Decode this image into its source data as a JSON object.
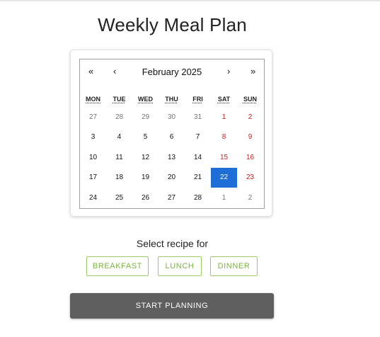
{
  "page": {
    "title": "Weekly Meal Plan"
  },
  "calendar": {
    "nav": {
      "prev_year": "«",
      "prev_month": "‹",
      "next_month": "›",
      "next_year": "»"
    },
    "month_label": "February 2025",
    "weekdays": [
      "MON",
      "TUE",
      "WED",
      "THU",
      "FRI",
      "SAT",
      "SUN"
    ],
    "weeks": [
      [
        {
          "d": "27",
          "other": true
        },
        {
          "d": "28",
          "other": true
        },
        {
          "d": "29",
          "other": true
        },
        {
          "d": "30",
          "other": true
        },
        {
          "d": "31",
          "other": true
        },
        {
          "d": "1"
        },
        {
          "d": "2"
        }
      ],
      [
        {
          "d": "3"
        },
        {
          "d": "4"
        },
        {
          "d": "5"
        },
        {
          "d": "6"
        },
        {
          "d": "7"
        },
        {
          "d": "8"
        },
        {
          "d": "9"
        }
      ],
      [
        {
          "d": "10"
        },
        {
          "d": "11"
        },
        {
          "d": "12"
        },
        {
          "d": "13"
        },
        {
          "d": "14"
        },
        {
          "d": "15"
        },
        {
          "d": "16"
        }
      ],
      [
        {
          "d": "17"
        },
        {
          "d": "18"
        },
        {
          "d": "19"
        },
        {
          "d": "20"
        },
        {
          "d": "21"
        },
        {
          "d": "22",
          "selected": true
        },
        {
          "d": "23"
        }
      ],
      [
        {
          "d": "24"
        },
        {
          "d": "25"
        },
        {
          "d": "26"
        },
        {
          "d": "27"
        },
        {
          "d": "28"
        },
        {
          "d": "1",
          "other": true
        },
        {
          "d": "2",
          "other": true
        }
      ]
    ],
    "colors": {
      "weekend": "#cc1f1f",
      "selected": "#1f6ed8",
      "other_month": "#777777"
    }
  },
  "recipe": {
    "prompt": "Select recipe for",
    "meals": [
      "BREAKFAST",
      "LUNCH",
      "DINNER"
    ]
  },
  "actions": {
    "start_label": "START PLANNING"
  }
}
